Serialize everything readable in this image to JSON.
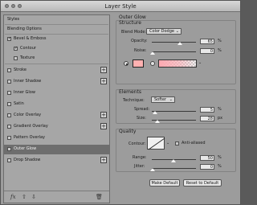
{
  "window": {
    "title": "Layer Style"
  },
  "sidebar": {
    "header": "Styles",
    "items": [
      {
        "label": "Blending Options"
      },
      {
        "label": "Bevel & Emboss",
        "checked": true
      },
      {
        "label": "Contour",
        "checked": true
      },
      {
        "label": "Texture",
        "checked": false
      },
      {
        "label": "Stroke",
        "checked": false
      },
      {
        "label": "Inner Shadow",
        "checked": false
      },
      {
        "label": "Inner Glow",
        "checked": false
      },
      {
        "label": "Satin",
        "checked": false
      },
      {
        "label": "Color Overlay",
        "checked": false
      },
      {
        "label": "Gradient Overlay",
        "checked": false
      },
      {
        "label": "Pattern Overlay",
        "checked": false
      },
      {
        "label": "Outer Glow",
        "checked": false,
        "selected": true
      },
      {
        "label": "Drop Shadow",
        "checked": false
      }
    ],
    "footer": {
      "fx": "fx",
      "up": "⇧",
      "down": "⇩",
      "trash": "🗑"
    }
  },
  "outer_glow": {
    "title": "Outer Glow",
    "structure": {
      "heading": "Structure",
      "blend_mode_label": "Blend Mode:",
      "blend_mode_value": "Color Dodge",
      "opacity_label": "Opacity:",
      "opacity_value": "65",
      "opacity_unit": "%",
      "noise_label": "Noise:",
      "noise_value": "0",
      "noise_unit": "%",
      "glow_color": "#ffb1b1"
    },
    "elements": {
      "heading": "Elements",
      "technique_label": "Technique:",
      "technique_value": "Softer",
      "spread_label": "Spread:",
      "spread_value": "5",
      "spread_unit": "%",
      "size_label": "Size:",
      "size_value": "28",
      "size_unit": "px"
    },
    "quality": {
      "heading": "Quality",
      "contour_label": "Contour:",
      "anti_aliased_label": "Anti-aliased",
      "range_label": "Range:",
      "range_value": "50",
      "range_unit": "%",
      "jitter_label": "Jitter:",
      "jitter_value": "0",
      "jitter_unit": "%"
    },
    "buttons": {
      "make_default": "Make Default",
      "reset_default": "Reset to Default"
    }
  }
}
